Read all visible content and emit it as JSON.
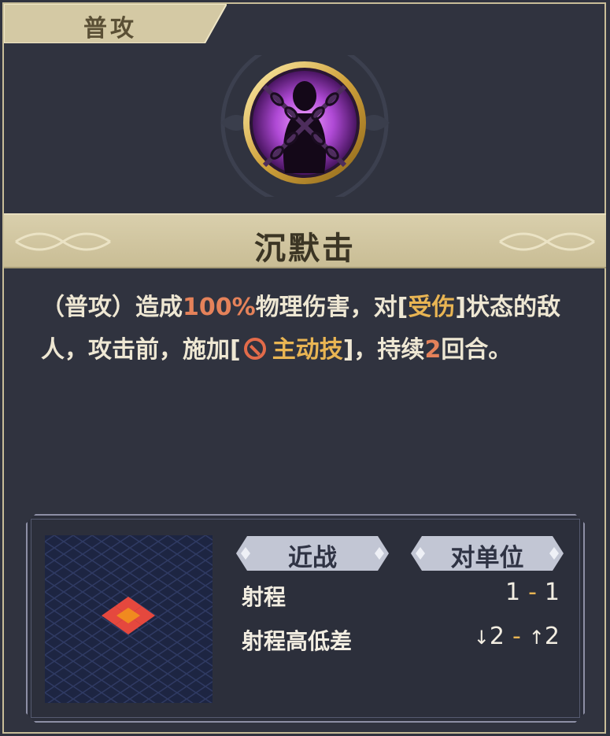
{
  "category_tab": {
    "label": "普攻"
  },
  "skill": {
    "icon_name": "chained-silhouette-icon",
    "name": "沉默击",
    "description": {
      "part1": "（普攻）造成",
      "damage_pct": "100%",
      "part2": "物理伤害，对[",
      "status": "受伤",
      "part3": "]状态的敌人，攻击前，施加[",
      "effect_icon": "ban-icon",
      "effect": "主动技",
      "part4": "]，持续",
      "duration": "2",
      "part5": "回合。"
    }
  },
  "info": {
    "tags": [
      "近战",
      "对单位"
    ],
    "range_label": "射程",
    "range_min": "1",
    "range_max": "1",
    "height_label": "射程高低差",
    "height_down": "2",
    "height_up": "2"
  },
  "colors": {
    "highlight_number": "#e5825a",
    "highlight_keyword": "#e9b553",
    "target_tile_center": "#f08a1f",
    "target_tile_adjacent": "#e5483e"
  }
}
